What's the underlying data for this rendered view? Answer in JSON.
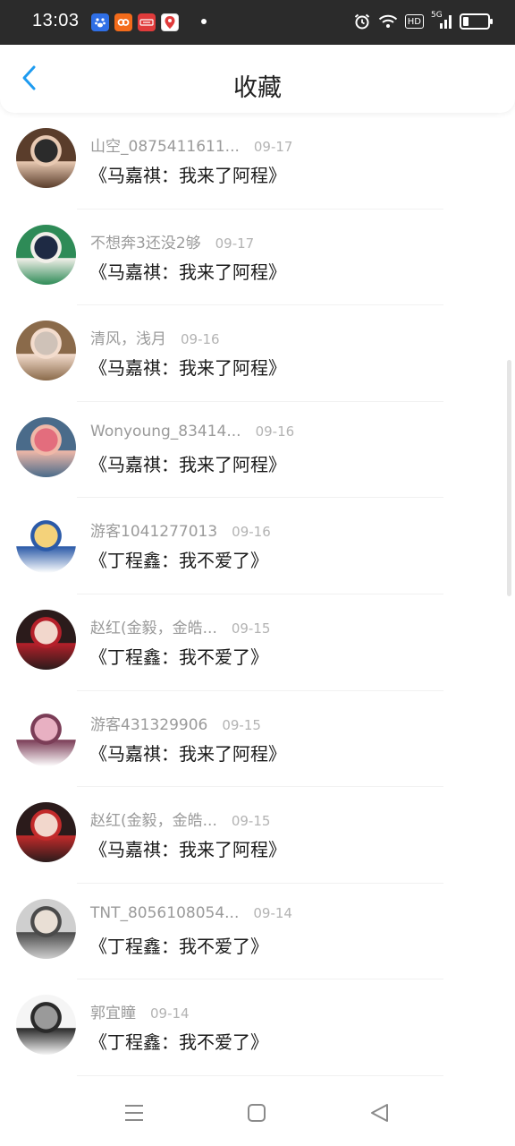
{
  "status_bar": {
    "time": "13:03",
    "app_icons": [
      "baidu-icon",
      "app-orange-icon",
      "news-red-icon",
      "map-pin-icon"
    ],
    "system_icons": [
      "alarm-icon",
      "wifi-icon",
      "hd-icon",
      "5g-signal-icon",
      "battery-icon"
    ],
    "hd_label": "HD",
    "network_label": "5G"
  },
  "header": {
    "title": "收藏",
    "back_icon": "chevron-left-icon",
    "accent_color": "#1e9bf0"
  },
  "favorites": [
    {
      "username": "山空_0875411611...",
      "date": "09-17",
      "title": "《马嘉祺：我来了阿程》",
      "avatar_palette": [
        "#5a3d2b",
        "#e8c9b2",
        "#2b2b2b"
      ]
    },
    {
      "username": "不想奔3还没2够",
      "date": "09-17",
      "title": "《马嘉祺：我来了阿程》",
      "avatar_palette": [
        "#2e8b57",
        "#f1efe9",
        "#1e2a44"
      ]
    },
    {
      "username": "清风，浅月",
      "date": "09-16",
      "title": "《马嘉祺：我来了阿程》",
      "avatar_palette": [
        "#8a6a4a",
        "#f3dccd",
        "#cfc2b8"
      ]
    },
    {
      "username": "Wonyoung_83414...",
      "date": "09-16",
      "title": "《马嘉祺：我来了阿程》",
      "avatar_palette": [
        "#4a6b8a",
        "#f0b8a8",
        "#e36d7d"
      ]
    },
    {
      "username": "游客1041277013",
      "date": "09-16",
      "title": "《丁程鑫：我不爱了》",
      "avatar_palette": [
        "#ffffff",
        "#2b5aa8",
        "#f4d27a"
      ]
    },
    {
      "username": "赵红(金毅，金皓...",
      "date": "09-15",
      "title": "《丁程鑫：我不爱了》",
      "avatar_palette": [
        "#2b1b1b",
        "#b5202a",
        "#f2d7cc"
      ]
    },
    {
      "username": "游客431329906",
      "date": "09-15",
      "title": "《马嘉祺：我来了阿程》",
      "avatar_palette": [
        "#ffffff",
        "#7b3d57",
        "#e8b0c2"
      ]
    },
    {
      "username": "赵红(金毅，金皓...",
      "date": "09-15",
      "title": "《马嘉祺：我来了阿程》",
      "avatar_palette": [
        "#2b1b1b",
        "#c22a2a",
        "#f2d7cc"
      ]
    },
    {
      "username": "TNT_8056108054...",
      "date": "09-14",
      "title": "《丁程鑫：我不爱了》",
      "avatar_palette": [
        "#cfcfcf",
        "#4a4a4a",
        "#e9dfd5"
      ]
    },
    {
      "username": "郭宜瞳",
      "date": "09-14",
      "title": "《丁程鑫：我不爱了》",
      "avatar_palette": [
        "#f5f5f5",
        "#2a2a2a",
        "#9a9a9a"
      ]
    }
  ],
  "nav_bar": {
    "buttons": [
      "menu-icon",
      "home-icon",
      "back-icon"
    ]
  }
}
